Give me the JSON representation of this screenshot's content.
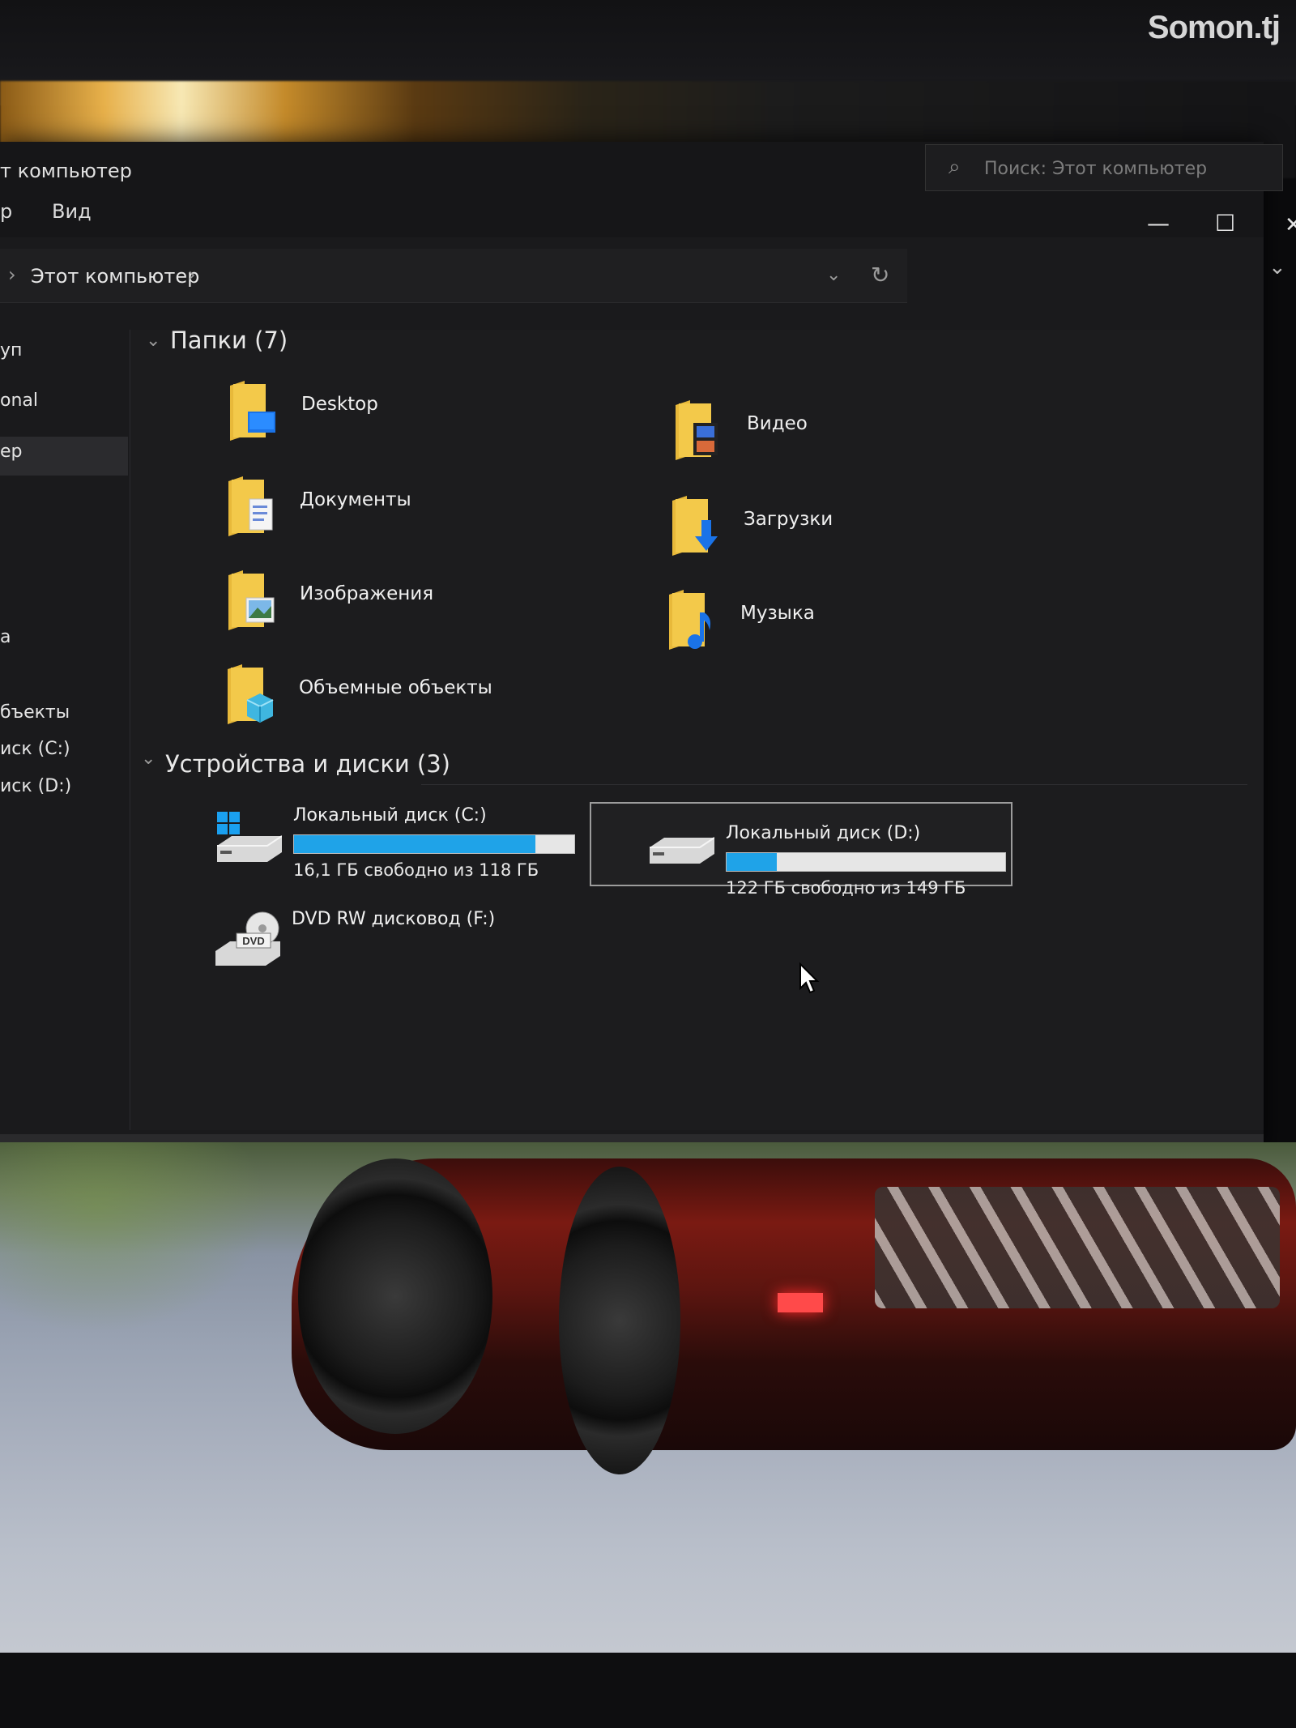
{
  "watermark": "Somon.tj",
  "window": {
    "title": "т компьютер",
    "ribbon_tabs": [
      "р",
      "Вид"
    ],
    "controls": {
      "minimize": "—",
      "maximize": "☐",
      "close": "✕"
    }
  },
  "addressbar": {
    "crumbs": [
      "›",
      "Этот компьютер",
      "›"
    ],
    "dropdown_icon": "chevron-down-icon",
    "refresh_icon": "refresh-icon"
  },
  "search": {
    "placeholder": "Поиск: Этот компьютер"
  },
  "sidebar": {
    "items": [
      "уп",
      "onal",
      "ер",
      "а",
      "бъекты",
      "иск (C:)",
      "иск (D:)"
    ],
    "selected_index": 2
  },
  "folders_section": {
    "header": "Папки (7)",
    "items": [
      {
        "label": "Desktop",
        "icon": "desktop-folder-icon"
      },
      {
        "label": "Документы",
        "icon": "documents-folder-icon"
      },
      {
        "label": "Изображения",
        "icon": "pictures-folder-icon"
      },
      {
        "label": "Объемные объекты",
        "icon": "3d-objects-folder-icon"
      },
      {
        "label": "Видео",
        "icon": "videos-folder-icon"
      },
      {
        "label": "Загрузки",
        "icon": "downloads-folder-icon"
      },
      {
        "label": "Музыка",
        "icon": "music-folder-icon"
      }
    ]
  },
  "devices_section": {
    "header": "Устройства и диски (3)",
    "drives": [
      {
        "name": "Локальный диск (C:)",
        "free_text": "16,1 ГБ свободно из 118 ГБ",
        "used_fraction": 0.86,
        "icon": "windows-drive-icon"
      },
      {
        "name": "Локальный диск (D:)",
        "free_text": "122 ГБ свободно из 149 ГБ",
        "used_fraction": 0.18,
        "icon": "hard-drive-icon",
        "selected": true
      },
      {
        "name": "DVD RW дисковод (F:)",
        "icon": "dvd-drive-icon"
      }
    ]
  },
  "colors": {
    "accent": "#1fa3e8",
    "folder": "#f3c94a",
    "window_bg": "#1c1c1e"
  }
}
